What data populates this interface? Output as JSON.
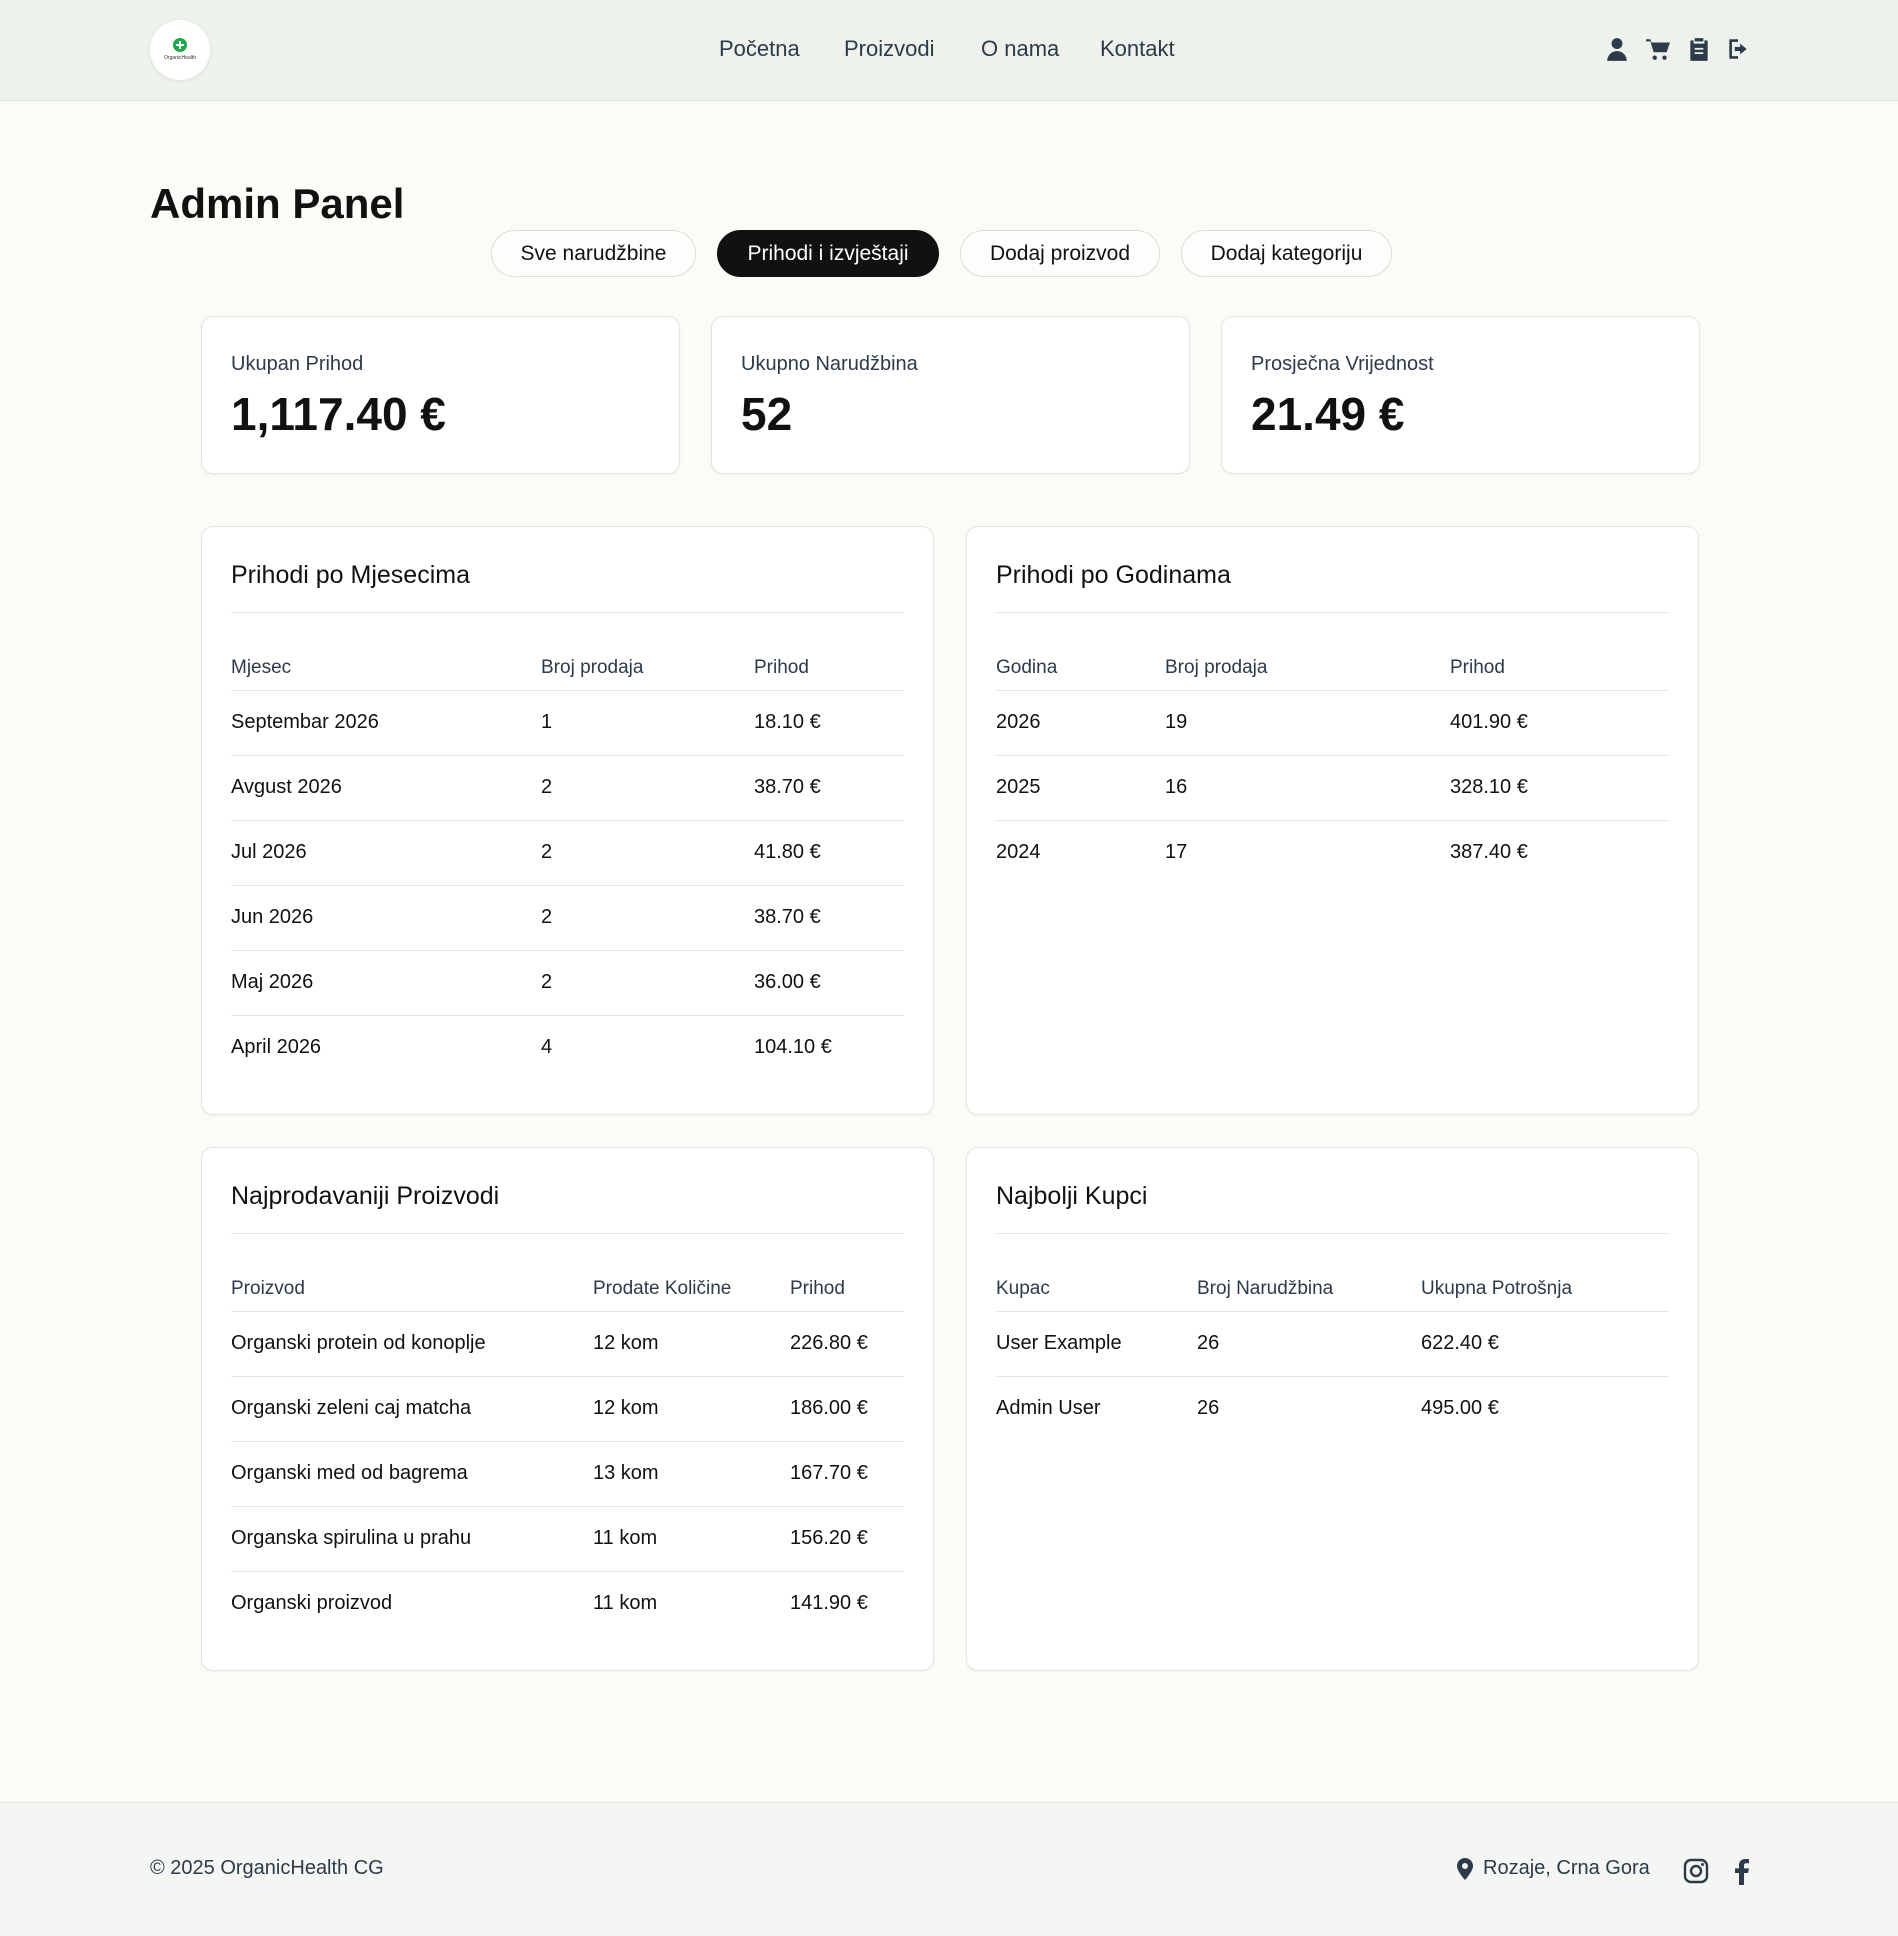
{
  "header": {
    "logo_text": "OrganicHealth",
    "nav": [
      "Početna",
      "Proizvodi",
      "O nama",
      "Kontakt"
    ],
    "icons": [
      "user-icon",
      "cart-icon",
      "clipboard-icon",
      "logout-icon"
    ]
  },
  "page": {
    "title": "Admin Panel",
    "tabs": [
      "Sve narudžbine",
      "Prihodi i izvještaji",
      "Dodaj proizvod",
      "Dodaj kategoriju"
    ],
    "active_tab": "Prihodi i izvještaji"
  },
  "stats": [
    {
      "label": "Ukupan Prihod",
      "value": "1,117.40 €"
    },
    {
      "label": "Ukupno Narudžbina",
      "value": "52"
    },
    {
      "label": "Prosječna Vrijednost",
      "value": "21.49 €"
    }
  ],
  "monthly": {
    "title": "Prihodi po Mjesecima",
    "headers": [
      "Mjesec",
      "Broj prodaja",
      "Prihod"
    ],
    "rows": [
      [
        "Septembar 2026",
        "1",
        "18.10 €"
      ],
      [
        "Avgust 2026",
        "2",
        "38.70 €"
      ],
      [
        "Jul 2026",
        "2",
        "41.80 €"
      ],
      [
        "Jun 2026",
        "2",
        "38.70 €"
      ],
      [
        "Maj 2026",
        "2",
        "36.00 €"
      ],
      [
        "April 2026",
        "4",
        "104.10 €"
      ]
    ]
  },
  "yearly": {
    "title": "Prihodi po Godinama",
    "headers": [
      "Godina",
      "Broj prodaja",
      "Prihod"
    ],
    "rows": [
      [
        "2026",
        "19",
        "401.90 €"
      ],
      [
        "2025",
        "16",
        "328.10 €"
      ],
      [
        "2024",
        "17",
        "387.40 €"
      ]
    ]
  },
  "products": {
    "title": "Najprodavaniji Proizvodi",
    "headers": [
      "Proizvod",
      "Prodate Količine",
      "Prihod"
    ],
    "rows": [
      [
        "Organski protein od konoplje",
        "12 kom",
        "226.80 €"
      ],
      [
        "Organski zeleni caj matcha",
        "12 kom",
        "186.00 €"
      ],
      [
        "Organski med od bagrema",
        "13 kom",
        "167.70 €"
      ],
      [
        "Organska spirulina u prahu",
        "11 kom",
        "156.20 €"
      ],
      [
        "Organski proizvod",
        "11 kom",
        "141.90 €"
      ]
    ]
  },
  "customers": {
    "title": "Najbolji Kupci",
    "headers": [
      "Kupac",
      "Broj Narudžbina",
      "Ukupna Potrošnja"
    ],
    "rows": [
      [
        "User Example",
        "26",
        "622.40 €"
      ],
      [
        "Admin User",
        "26",
        "495.00 €"
      ]
    ]
  },
  "footer": {
    "copyright": "© 2025 OrganicHealth CG",
    "location": "Rozaje, Crna Gora",
    "social": [
      "instagram-icon",
      "facebook-icon"
    ]
  },
  "colors": {
    "header_bg": "#edf3ec",
    "page_bg": "#fbfcf8",
    "accent": "#1faa4a",
    "active_tab_bg": "#111111",
    "text_muted": "#2d3a4a"
  }
}
